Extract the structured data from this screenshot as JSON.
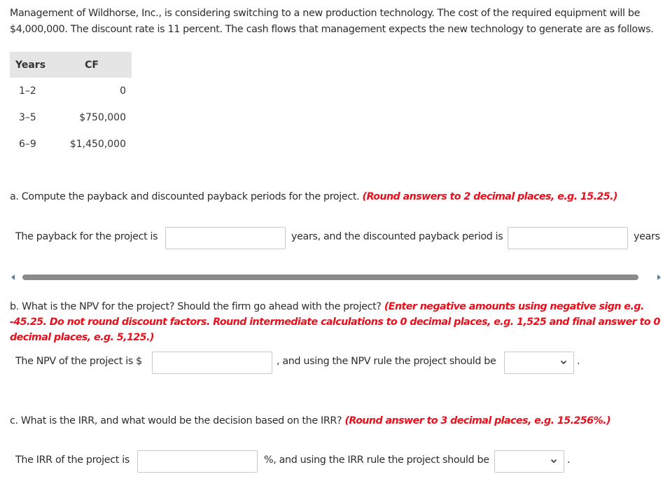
{
  "problem": {
    "intro": "Management of Wildhorse, Inc., is considering switching to a new production technology. The cost of the required equipment will be $4,000,000. The discount rate is 11 percent. The cash flows that management expects the new technology to generate are as follows."
  },
  "cf_table": {
    "headers": [
      "Years",
      "CF"
    ],
    "rows": [
      {
        "years": "1–2",
        "cf": "0"
      },
      {
        "years": "3–5",
        "cf": "$750,000"
      },
      {
        "years": "6–9",
        "cf": "$1,450,000"
      }
    ]
  },
  "part_a": {
    "question": "a. Compute the payback and discounted payback periods for the project.",
    "hint": "(Round answers to 2 decimal places, e.g. 15.25.)",
    "label_payback": "The payback for the project is",
    "payback_value": "",
    "label_mid": "years, and the discounted payback period is",
    "discounted_value": "",
    "label_end": "years"
  },
  "part_b": {
    "question": "b. What is the NPV for the project? Should the firm go ahead with the project?",
    "hint": "(Enter negative amounts using negative sign e.g. -45.25. Do not round discount factors. Round intermediate calculations to 0 decimal places, e.g. 1,525 and final answer to 0 decimal places, e.g. 5,125.)",
    "label_npv": "The NPV of the project is $",
    "npv_value": "",
    "label_mid": ", and using the NPV rule the project should be",
    "decision_selected": "",
    "label_end": "."
  },
  "part_c": {
    "question": "c. What is the IRR, and what would be the decision based on the IRR?",
    "hint": "(Round answer to 3 decimal places, e.g. 15.256%.)",
    "label_irr": "The IRR of the project is",
    "irr_value": "",
    "label_mid": "%, and using the IRR rule the project should be",
    "decision_selected": "",
    "label_end": "."
  },
  "icons": {
    "scroll_left": "triangle-left",
    "scroll_right": "triangle-right",
    "select_chevron": "chevron-down"
  }
}
